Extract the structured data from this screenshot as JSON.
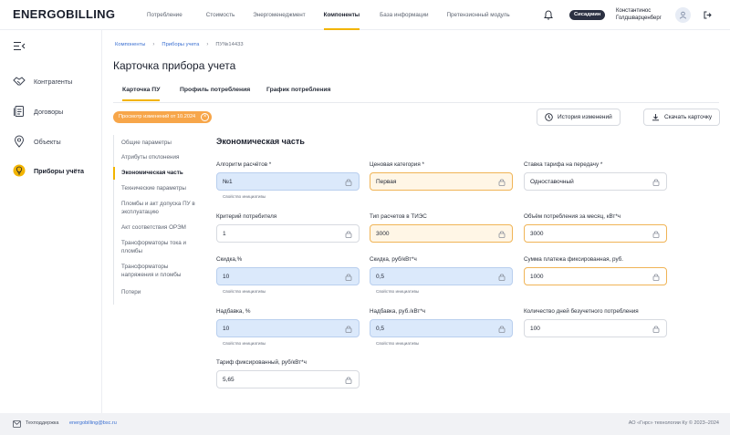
{
  "app": {
    "logo": "ENERGOBILLING"
  },
  "nav": {
    "items": [
      "Потребление",
      "Стоимость",
      "Энергоменеджмент",
      "Компоненты",
      "База информации",
      "Претензионный модуль"
    ],
    "active": "Компоненты"
  },
  "user": {
    "role_badge": "Сисадмин",
    "name": "Константинос Голдшварценберг"
  },
  "sidebar": {
    "items": [
      {
        "label": "Контрагенты",
        "icon": "handshake-icon"
      },
      {
        "label": "Договоры",
        "icon": "document-icon"
      },
      {
        "label": "Объекты",
        "icon": "location-pin-icon"
      },
      {
        "label": "Приборы учёта",
        "icon": "lightbulb-icon",
        "active": true
      }
    ]
  },
  "breadcrumb": {
    "items": [
      "Компоненты",
      "Приборы учета",
      "ПУ№14433"
    ]
  },
  "page": {
    "title": "Карточка прибора учета"
  },
  "tabs": {
    "items": [
      "Карточка ПУ",
      "Профиль потребления",
      "График потребления"
    ],
    "active": "Карточка ПУ"
  },
  "history_chip": {
    "label": "Просмотр изменений от 10.2024"
  },
  "toolbar": {
    "history_label": "История изменений",
    "download_label": "Скачать карточку"
  },
  "section_nav": {
    "items": [
      "Общие параметры",
      "Атрибуты отклонения",
      "Экономическая часть",
      "Технические параметры",
      "Пломбы и акт допуска ПУ в эксплуатацию",
      "Акт соответствия ОРЭМ",
      "Трансформаторы тока и пломбы",
      "Трансформаторы напряжения и пломбы",
      "Потери"
    ],
    "active": "Экономическая часть"
  },
  "section": {
    "title": "Экономическая часть"
  },
  "fields": {
    "calc_algorithm": {
      "label": "Алгоритм расчётов *",
      "value": "№1",
      "hint": "Свойство инициативы",
      "state": "blue"
    },
    "price_category": {
      "label": "Ценовая категория *",
      "value": "Первая",
      "state": "orange"
    },
    "transfer_tariff": {
      "label": "Ставка тарифа на передачу *",
      "value": "Одноставочный",
      "state": "normal"
    },
    "consumer_criterion": {
      "label": "Критерий потребителя",
      "value": "1",
      "state": "normal"
    },
    "tieс_type": {
      "label": "Тип расчетов в ТИЭС",
      "value": "3000",
      "state": "orange"
    },
    "monthly_volume": {
      "label": "Объём потребления за месяц, кВт*ч",
      "value": "3000",
      "state": "orange-white"
    },
    "discount_pct": {
      "label": "Скидка,%",
      "value": "10",
      "hint": "Свойство инициативы",
      "state": "blue"
    },
    "discount_rub": {
      "label": "Скидка, руб/кВт*ч",
      "value": "0,5",
      "hint": "Свойство инициативы",
      "state": "blue"
    },
    "fixed_payment": {
      "label": "Сумма платежа фиксированная, руб.",
      "value": "1000",
      "state": "orange-white"
    },
    "markup_pct": {
      "label": "Надбавка, %",
      "value": "10",
      "hint": "Свойство инициативы",
      "state": "blue"
    },
    "markup_rub": {
      "label": "Надбавка, руб./кВт*ч",
      "value": "0,5",
      "hint": "Свойство инициативы",
      "state": "blue"
    },
    "nonmetered_days": {
      "label": "Количество дней безучетного потребления",
      "value": "100",
      "state": "normal"
    },
    "fixed_tariff": {
      "label": "Тариф фиксированный, руб/кВт*ч",
      "value": "5,65",
      "state": "normal"
    }
  },
  "footer": {
    "support_label": "Техподдержка",
    "support_email": "energobilling@bsc.ru",
    "copyright": "АО «Гнрс» технологии Ку © 2023–2024"
  },
  "colors": {
    "accent": "#f2b400",
    "chip": "#f7a64a",
    "link": "#3a6fd1",
    "blue_field": "#dbe9fb",
    "orange_border": "#f0b456"
  }
}
